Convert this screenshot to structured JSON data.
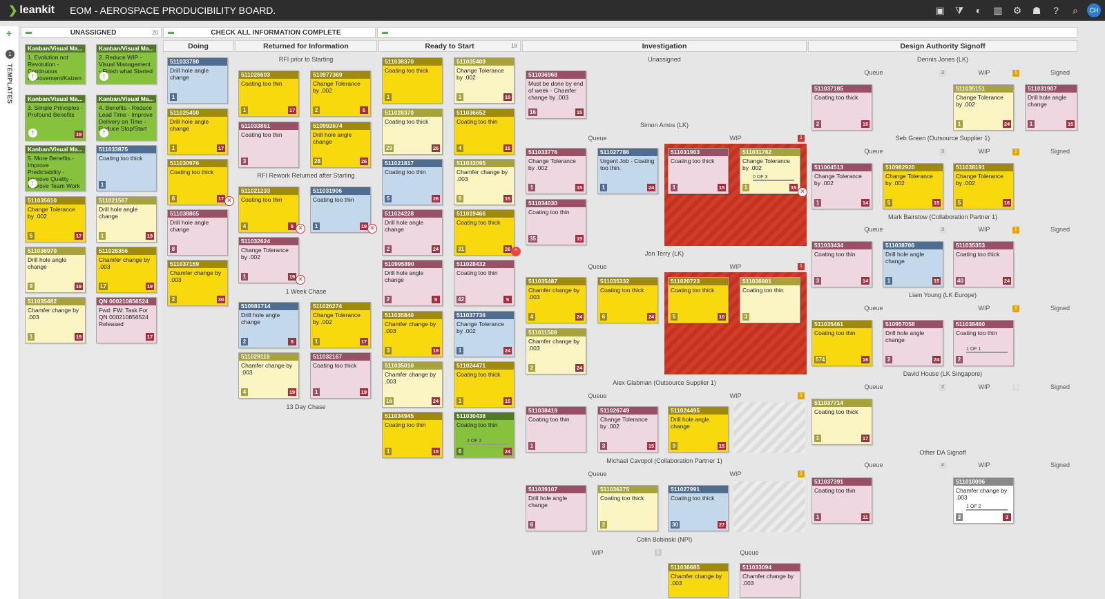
{
  "app": {
    "logo": "leankit",
    "title": "EOM - AEROSPACE PRODUCIBILITY BOARD.",
    "avatar": "CH"
  },
  "toolbar": {
    "icons": [
      "board-icon",
      "filter-icon",
      "user-filter-icon",
      "report-icon",
      "gear-icon",
      "users-icon",
      "help-icon",
      "search-icon"
    ]
  },
  "left_bar": {
    "plus": "+",
    "count": "1",
    "templates": "TEMPLATES"
  },
  "columns": {
    "unassigned": {
      "title": "UNASSIGNED",
      "count": "20"
    },
    "check": {
      "title": "CHECK ALL INFORMATION COMPLETE"
    },
    "doing": {
      "title": "Doing"
    },
    "returned": {
      "title": "Returned for Information"
    },
    "ready": {
      "title": "Ready to Start",
      "count": "18"
    },
    "investigation": {
      "title": "Investigation"
    },
    "design": {
      "title": "Design Authority Signoff"
    }
  },
  "sublanes": {
    "rfi_prior": "RFI prior to Starting",
    "rfi_rework": "RFI Rework Returned after Starting",
    "week_chase": "1 Week Chase",
    "day13": "13 Day Chase",
    "unassigned_inv": "Unassigned",
    "simon": "Simon Amos (LK)",
    "jon": "Jon Terry (LK)",
    "alex": "Alex Glabman (Outsource Supplier 1)",
    "michael": "Michael Cavopol (Collaboration Partner 1)",
    "colin": "Colin Bobinski (NPI)",
    "dennis": "Dennis Jones (LK)",
    "seb": "Seb Green (Outsource Supplier 1)",
    "mark": "Mark Bairstow (Collaboration Partner 1)",
    "liam": "Liam Young (LK Europe)",
    "david": "David House (LK Singapore)",
    "other": "Other DA Signoff",
    "queue": "Queue",
    "wip": "WIP",
    "signed": "Signed"
  },
  "cards": [
    {
      "id": "Kanban/Visual Ma...",
      "t": "1. Evolution not Revolution - Continuous Improvement/Kaizen",
      "c": "gr",
      "sz": ""
    },
    {
      "id": "Kanban/Visual Ma...",
      "t": "2. Reduce WIP - Visual Management - Finish what Started",
      "c": "gr",
      "sz": ""
    },
    {
      "id": "Kanban/Visual Ma...",
      "t": "3. Simple Principles - Profound Benefits",
      "c": "gr",
      "sz": "",
      "dd": "19"
    },
    {
      "id": "Kanban/Visual Ma...",
      "t": "4. Benefits - Reduce Lead Time - Improve Delivery on Time - Reduce Stop/Start",
      "c": "gr",
      "sz": ""
    },
    {
      "id": "Kanban/Visual Ma...",
      "t": "5. More Benefits - Improve Predictability - Improve Quality - Improve Team Work",
      "c": "gr",
      "sz": ""
    },
    {
      "id": "511033875",
      "t": "Coating too thick",
      "c": "bl",
      "sz": "1"
    },
    {
      "id": "511035610",
      "t": "Change Tolerance by .002",
      "c": "y",
      "sz": "5",
      "dd": "17"
    },
    {
      "id": "511021567",
      "t": "Drill hole angle change",
      "c": "ly",
      "sz": "1",
      "dd": "19"
    },
    {
      "id": "511036970",
      "t": "Drill hole angle change",
      "c": "ly",
      "sz": "9",
      "dd": "19"
    },
    {
      "id": "511028356",
      "t": "Chamfer change by .003",
      "c": "y",
      "sz": "17",
      "dd": "19"
    },
    {
      "id": "511035482",
      "t": "Chamfer change by .003",
      "c": "ly",
      "sz": "1",
      "dd": "19"
    },
    {
      "id": "QN 000210856524",
      "t": "Fwd: FW: Task For QN 000210856524 Released",
      "c": "pk",
      "sz": "",
      "dd": "17"
    },
    {
      "id": "511033780",
      "t": "Drill hole angle change",
      "c": "bl",
      "sz": "1"
    },
    {
      "id": "511025400",
      "t": "Drill hole angle change",
      "c": "y",
      "sz": "1",
      "dd": "17"
    },
    {
      "id": "511030976",
      "t": "Coating too thick",
      "c": "y",
      "sz": "6",
      "dd": "17"
    },
    {
      "id": "511038865",
      "t": "Drill hole angle change",
      "c": "pk",
      "sz": "8"
    },
    {
      "id": "511037159",
      "t": "Chamfer change by .003",
      "c": "y",
      "sz": "2",
      "dd": "30"
    },
    {
      "id": "511026603",
      "t": "Coating too thin",
      "c": "y",
      "sz": "1",
      "dd": "17"
    },
    {
      "id": "510977369",
      "t": "Change Tolerance by .002",
      "c": "y",
      "sz": "2",
      "dd": "5"
    },
    {
      "id": "511033861",
      "t": "Coating too thin",
      "c": "pk",
      "sz": "3"
    },
    {
      "id": "510992674",
      "t": "Drill hole angle change",
      "c": "y",
      "sz": "28",
      "dd": "26"
    },
    {
      "id": "511021233",
      "t": "Coating too thin",
      "c": "y",
      "sz": "4",
      "dd": "5"
    },
    {
      "id": "511031906",
      "t": "Coating too thin",
      "c": "bl",
      "sz": "1",
      "dd": "19"
    },
    {
      "id": "511032624",
      "t": "Change Tolerance by .002",
      "c": "pk",
      "sz": "1",
      "dd": "19"
    },
    {
      "id": "510981714",
      "t": "Drill hole angle change",
      "c": "bl",
      "sz": "2",
      "dd": "5"
    },
    {
      "id": "511026274",
      "t": "Change Tolerance by .002",
      "c": "y",
      "sz": "1",
      "dd": "17"
    },
    {
      "id": "511029119",
      "t": "Chamfer change by .003",
      "c": "ly",
      "sz": "4",
      "dd": "19"
    },
    {
      "id": "511032167",
      "t": "Coating too thick",
      "c": "pk",
      "sz": "1",
      "dd": "19"
    },
    {
      "id": "511038370",
      "t": "Coating too thick",
      "c": "y",
      "sz": "1"
    },
    {
      "id": "511035409",
      "t": "Change Tolerance by .002",
      "c": "ly",
      "sz": "1",
      "dd": "19"
    },
    {
      "id": "511028370",
      "t": "Coating too thick",
      "c": "ly",
      "sz": "29",
      "dd": "26"
    },
    {
      "id": "511036652",
      "t": "Coating too thin",
      "c": "y",
      "sz": "4",
      "dd": "15"
    },
    {
      "id": "511021817",
      "t": "Coating too thin",
      "c": "bl",
      "sz": "5",
      "dd": "26"
    },
    {
      "id": "511033095",
      "t": "Chamfer change by .003",
      "c": "ly",
      "sz": "9",
      "dd": "15"
    },
    {
      "id": "511024228",
      "t": "Drill hole angle change",
      "c": "pk",
      "sz": "2",
      "dd": "24"
    },
    {
      "id": "511019466",
      "t": "Coating too thick",
      "c": "y",
      "sz": "31",
      "dd": "26"
    },
    {
      "id": "510995890",
      "t": "Drill hole angle change",
      "c": "pk",
      "sz": "2",
      "dd": "5"
    },
    {
      "id": "511028432",
      "t": "Coating too thin",
      "c": "pk",
      "sz": "42",
      "dd": "5"
    },
    {
      "id": "511035840",
      "t": "Chamfer change by .003",
      "c": "y",
      "sz": "3",
      "dd": "19"
    },
    {
      "id": "511037736",
      "t": "Change Tolerance by .002",
      "c": "bl",
      "sz": "1",
      "dd": "24"
    },
    {
      "id": "511035010",
      "t": "Chamfer change by .003",
      "c": "ly",
      "sz": "16",
      "dd": "24"
    },
    {
      "id": "511024471",
      "t": "Coating too thick",
      "c": "y",
      "sz": "1",
      "dd": "15"
    },
    {
      "id": "511034945",
      "t": "Coating too thin",
      "c": "y",
      "sz": "1",
      "dd": "15"
    },
    {
      "id": "511030438",
      "t": "Coating too thin",
      "c": "gr",
      "sz": "6",
      "dd": "24",
      "task": "2 OF 2"
    },
    {
      "id": "511036968",
      "t": "Must be done by end of week - Chamfer change by .003",
      "c": "pk",
      "sz": "16",
      "dd": "15"
    },
    {
      "id": "511033776",
      "t": "Change Tolerance by .002",
      "c": "pk",
      "sz": "1",
      "dd": "15"
    },
    {
      "id": "511027786",
      "t": "Urgent Job - Coating too thin.",
      "c": "bl",
      "sz": "1",
      "dd": "24"
    },
    {
      "id": "511034030",
      "t": "Coating too thin",
      "c": "pk",
      "sz": "35",
      "dd": "15"
    },
    {
      "id": "511031903",
      "t": "Coating too thick",
      "c": "pk",
      "sz": "1",
      "dd": "15"
    },
    {
      "id": "511031782",
      "t": "Change Tolerance by .002",
      "c": "ly",
      "sz": "1",
      "dd": "15",
      "task": "0 OF 3"
    },
    {
      "id": "511035487",
      "t": "Chamfer change by .003",
      "c": "y",
      "sz": "4",
      "dd": "24"
    },
    {
      "id": "511035332",
      "t": "Coating too thick",
      "c": "y",
      "sz": "6",
      "dd": "24"
    },
    {
      "id": "511020723",
      "t": "Coating too thick",
      "c": "y",
      "sz": "5",
      "dd": "10"
    },
    {
      "id": "511036901",
      "t": "Coating too thin",
      "c": "ly",
      "sz": "3"
    },
    {
      "id": "511011508",
      "t": "Chamfer change by .003",
      "c": "ly",
      "sz": "2",
      "dd": "24"
    },
    {
      "id": "511038419",
      "t": "Coating too thin",
      "c": "pk",
      "sz": "1"
    },
    {
      "id": "511026749",
      "t": "Change Tolerance by .002",
      "c": "pk",
      "sz": "3",
      "dd": "15"
    },
    {
      "id": "511024495",
      "t": "Drill hole angle change",
      "c": "y",
      "sz": "9",
      "dd": "15"
    },
    {
      "id": "511039107",
      "t": "Drill hole angle change",
      "c": "pk",
      "sz": "6"
    },
    {
      "id": "511036275",
      "t": "Coating too thick",
      "c": "ly",
      "sz": "2"
    },
    {
      "id": "511027991",
      "t": "Coating too thick",
      "c": "bl",
      "sz": "30",
      "dd": "27"
    },
    {
      "id": "511036685",
      "t": "Chamfer change by .003",
      "c": "y",
      "sz": ""
    },
    {
      "id": "511033094",
      "t": "Chamfer change by .003",
      "c": "pk",
      "sz": ""
    },
    {
      "id": "511037185",
      "t": "Coating too thick",
      "c": "pk",
      "sz": "2",
      "dd": "15"
    },
    {
      "id": "511035151",
      "t": "Change Tolerance by .002",
      "c": "ly",
      "sz": "1",
      "dd": "24"
    },
    {
      "id": "511031907",
      "t": "Drill hole angle change",
      "c": "pk",
      "sz": "1",
      "dd": "15"
    },
    {
      "id": "511004513",
      "t": "Change Tolerance by .002",
      "c": "pk",
      "sz": "1",
      "dd": "14"
    },
    {
      "id": "510982920",
      "t": "Change Tolerance by .002",
      "c": "y",
      "sz": "5",
      "dd": "15"
    },
    {
      "id": "511038191",
      "t": "Change Tolerance by .002",
      "c": "y",
      "sz": "5",
      "dd": "16"
    },
    {
      "id": "511033434",
      "t": "Coating too thin",
      "c": "pk",
      "sz": "3",
      "dd": "14"
    },
    {
      "id": "511038706",
      "t": "Drill hole angle change",
      "c": "bl",
      "sz": "1",
      "dd": "15"
    },
    {
      "id": "511035353",
      "t": "Coating too thick",
      "c": "pk",
      "sz": "40",
      "dd": "24"
    },
    {
      "id": "511035461",
      "t": "Coating too thin",
      "c": "y",
      "sz": "574",
      "dd": "16"
    },
    {
      "id": "510957058",
      "t": "Drill hole angle change",
      "c": "pk",
      "sz": "2",
      "dd": "24"
    },
    {
      "id": "511038460",
      "t": "Coating too thin",
      "c": "pk",
      "sz": "2",
      "task": "1 OF 1"
    },
    {
      "id": "511037714",
      "t": "Coating too thick",
      "c": "ly",
      "sz": "1",
      "dd": "17"
    },
    {
      "id": "511037391",
      "t": "Coating too thin",
      "c": "pk",
      "sz": "1",
      "dd": "11"
    },
    {
      "id": "511018096",
      "t": "Chamfer change by .003",
      "c": "wh",
      "sz": "3",
      "dd": "3",
      "task": "1 OF 2"
    }
  ],
  "lane_counts": {
    "dennis_q": "3",
    "dennis_w": "1",
    "seb_q": "3",
    "seb_w": "1",
    "mark_q": "3",
    "mark_w": "1",
    "liam_w": "1",
    "david_q": "2",
    "david_w": "1",
    "other_q": "4",
    "simon_w": "1",
    "jon_w": "1",
    "alex_w": "1",
    "michael_w": "1",
    "colin_w": "1"
  }
}
